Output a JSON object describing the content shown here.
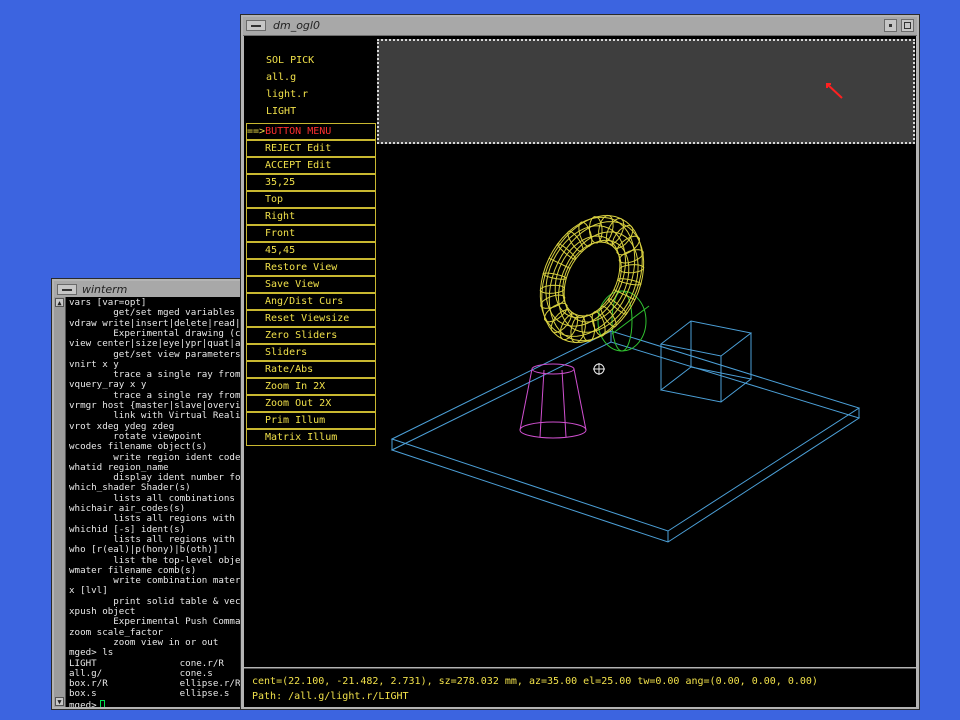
{
  "winterm": {
    "title": "winterm",
    "lines": [
      "vars [var=opt]",
      "        get/set mged variables",
      "vdraw write|insert|delete|read|",
      "        Experimental drawing (cnt",
      "view center|size|eye|ypr|quat|ae",
      "        get/set view parameters",
      "vnirt x y",
      "        trace a single ray from",
      "vquery_ray x y",
      "        trace a single ray from",
      "vrmgr host {master|slave|overvi",
      "        link with Virtual Reali",
      "vrot xdeg ydeg zdeg",
      "        rotate viewpoint",
      "wcodes filename object(s)",
      "        write region ident codes",
      "whatid region_name",
      "        display ident number fo",
      "which_shader Shader(s)",
      "        lists all combinations ",
      "whichair air_codes(s)",
      "        lists all regions with ",
      "whichid [-s] ident(s)",
      "        lists all regions with ",
      "who [r(eal)|p(hony)|b(oth)]",
      "        list the top-level obje",
      "wmater filename comb(s)",
      "        write combination mater",
      "x [lvl]",
      "        print solid table & vec",
      "xpush object",
      "        Experimental Push Comman",
      "zoom scale_factor",
      "        zoom view in or out",
      "mged> ls",
      "LIGHT               cone.r/R",
      "all.g/              cone.s",
      "box.r/R             ellipse.r/R",
      "box.s               ellipse.s"
    ],
    "prompt": "mged>"
  },
  "dm": {
    "title": "dm_ogl0",
    "header": [
      "SOL PICK",
      "all.g",
      "light.r",
      "LIGHT"
    ],
    "menu_indicator": "==>",
    "menu_title": "BUTTON MENU",
    "menu_items": [
      "REJECT Edit",
      "ACCEPT Edit",
      "35,25",
      "Top",
      "Right",
      "Front",
      "45,45",
      "Restore View",
      "Save View",
      "Ang/Dist Curs",
      "Reset Viewsize",
      "Zero Sliders",
      "Sliders",
      "Rate/Abs",
      "Zoom In 2X",
      "Zoom Out 2X",
      "Prim Illum",
      "Matrix Illum"
    ],
    "status_line1": "cent=(22.100, -21.482, 2.731), sz=278.032 mm, az=35.00 el=25.00 tw=0.00 ang=(0.00, 0.00, 0.00)",
    "status_line2": "Path: /all.g/light.r/LIGHT"
  },
  "colors": {
    "desktop": "#3c64e0",
    "menu_text": "#f0e04a",
    "menu_selected": "#ff3030",
    "torus": "#d8d040",
    "cone": "#d050d0",
    "box": "#4ca0d8",
    "light": "#30c030",
    "cursor": "#ff2020"
  }
}
